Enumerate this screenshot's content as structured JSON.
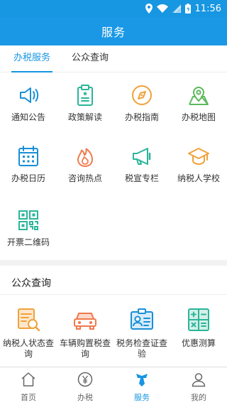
{
  "status_bar": {
    "time": "11:56"
  },
  "header": {
    "title": "服务"
  },
  "tabs": [
    {
      "label": "办税服务",
      "active": true
    },
    {
      "label": "公众查询",
      "active": false
    }
  ],
  "services": [
    {
      "label": "通知公告",
      "icon": "speaker-icon"
    },
    {
      "label": "政策解读",
      "icon": "clipboard-icon"
    },
    {
      "label": "办税指南",
      "icon": "compass-icon"
    },
    {
      "label": "办税地图",
      "icon": "map-pin-icon"
    },
    {
      "label": "办税日历",
      "icon": "calendar-icon"
    },
    {
      "label": "咨询热点",
      "icon": "flame-icon"
    },
    {
      "label": "税宣专栏",
      "icon": "megaphone-icon"
    },
    {
      "label": "纳税人学校",
      "icon": "graduation-cap-icon"
    },
    {
      "label": "开票二维码",
      "icon": "qr-code-icon"
    }
  ],
  "public_query": {
    "title": "公众查询",
    "items": [
      {
        "label": "纳税人状态查询",
        "icon": "document-search-icon"
      },
      {
        "label": "车辆购置税查询",
        "icon": "car-icon"
      },
      {
        "label": "税务检查证查验",
        "icon": "id-card-icon"
      },
      {
        "label": "优惠测算",
        "icon": "calculator-icon"
      }
    ]
  },
  "bottom_nav": [
    {
      "label": "首页",
      "icon": "home-icon",
      "active": false
    },
    {
      "label": "办税",
      "icon": "tax-coin-icon",
      "active": false
    },
    {
      "label": "服务",
      "icon": "service-tie-icon",
      "active": true
    },
    {
      "label": "我的",
      "icon": "user-icon",
      "active": false
    }
  ],
  "colors": {
    "primary": "#1796e2",
    "icon_blue": "#1a8fd6",
    "icon_green": "#2bb59a",
    "icon_orange": "#f0a23b",
    "icon_red": "#f07a4d",
    "nav_inactive": "#666666"
  }
}
